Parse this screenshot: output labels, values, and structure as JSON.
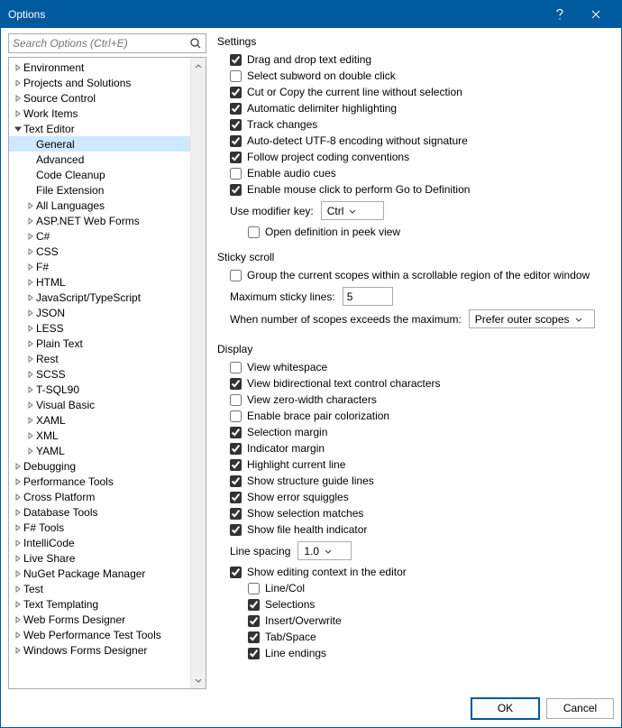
{
  "window": {
    "title": "Options"
  },
  "search": {
    "placeholder": "Search Options (Ctrl+E)"
  },
  "tree": {
    "top": [
      "Environment",
      "Projects and Solutions",
      "Source Control",
      "Work Items"
    ],
    "textEditor": "Text Editor",
    "textEditorChildren": [
      "General",
      "Advanced",
      "Code Cleanup",
      "File Extension"
    ],
    "textEditorLangs": [
      "All Languages",
      "ASP.NET Web Forms",
      "C#",
      "CSS",
      "F#",
      "HTML",
      "JavaScript/TypeScript",
      "JSON",
      "LESS",
      "Plain Text",
      "Rest",
      "SCSS",
      "T-SQL90",
      "Visual Basic",
      "XAML",
      "XML",
      "YAML"
    ],
    "bottom": [
      "Debugging",
      "Performance Tools",
      "Cross Platform",
      "Database Tools",
      "F# Tools",
      "IntelliCode",
      "Live Share",
      "NuGet Package Manager",
      "Test",
      "Text Templating",
      "Web Forms Designer",
      "Web Performance Test Tools",
      "Windows Forms Designer"
    ]
  },
  "settings": {
    "title": "Settings",
    "items": [
      {
        "label": "Drag and drop text editing",
        "checked": true
      },
      {
        "label": "Select subword on double click",
        "checked": false
      },
      {
        "label": "Cut or Copy the current line without selection",
        "checked": true
      },
      {
        "label": "Automatic delimiter highlighting",
        "checked": true
      },
      {
        "label": "Track changes",
        "checked": true
      },
      {
        "label": "Auto-detect UTF-8 encoding without signature",
        "checked": true
      },
      {
        "label": "Follow project coding conventions",
        "checked": true
      },
      {
        "label": "Enable audio cues",
        "checked": false
      },
      {
        "label": "Enable mouse click to perform Go to Definition",
        "checked": true
      }
    ],
    "modifierKeyLabel": "Use modifier key:",
    "modifierKeyValue": "Ctrl",
    "peek": {
      "label": "Open definition in peek view",
      "checked": false
    }
  },
  "sticky": {
    "title": "Sticky scroll",
    "group": {
      "label": "Group the current scopes within a scrollable region of the editor window",
      "checked": false
    },
    "maxLabel": "Maximum sticky lines:",
    "maxValue": "5",
    "exceedLabel": "When number of scopes exceeds the maximum:",
    "exceedValue": "Prefer outer scopes"
  },
  "display": {
    "title": "Display",
    "items": [
      {
        "label": "View whitespace",
        "checked": false
      },
      {
        "label": "View bidirectional text control characters",
        "checked": true
      },
      {
        "label": "View zero-width characters",
        "checked": false
      },
      {
        "label": "Enable brace pair colorization",
        "checked": false
      },
      {
        "label": "Selection margin",
        "checked": true
      },
      {
        "label": "Indicator margin",
        "checked": true
      },
      {
        "label": "Highlight current line",
        "checked": true
      },
      {
        "label": "Show structure guide lines",
        "checked": true
      },
      {
        "label": "Show error squiggles",
        "checked": true
      },
      {
        "label": "Show selection matches",
        "checked": true
      },
      {
        "label": "Show file health indicator",
        "checked": true
      }
    ],
    "lineSpacingLabel": "Line spacing",
    "lineSpacingValue": "1.0",
    "context": {
      "label": "Show editing context in the editor",
      "checked": true
    },
    "contextItems": [
      {
        "label": "Line/Col",
        "checked": false
      },
      {
        "label": "Selections",
        "checked": true
      },
      {
        "label": "Insert/Overwrite",
        "checked": true
      },
      {
        "label": "Tab/Space",
        "checked": true
      },
      {
        "label": "Line endings",
        "checked": true
      }
    ]
  },
  "buttons": {
    "ok": "OK",
    "cancel": "Cancel"
  }
}
